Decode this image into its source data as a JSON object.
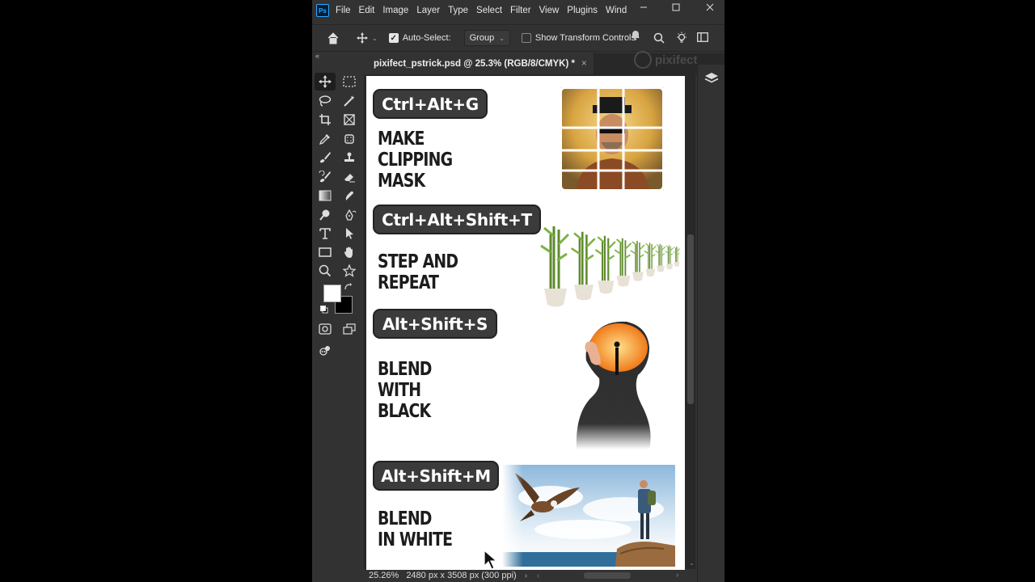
{
  "app": {
    "logo": "Ps",
    "menu": [
      "File",
      "Edit",
      "Image",
      "Layer",
      "Type",
      "Select",
      "Filter",
      "View",
      "Plugins",
      "Wind"
    ]
  },
  "options": {
    "auto_select_label": "Auto-Select:",
    "auto_select_checked": true,
    "group_value": "Group",
    "show_transform_label": "Show Transform Controls",
    "show_transform_checked": false
  },
  "collapse_glyph": "«",
  "tab": {
    "title": "pixifect_pstrick.psd @ 25.3% (RGB/8/CMYK) *",
    "close": "×"
  },
  "watermark": "pixifect",
  "shortcuts": [
    {
      "keys": "Ctrl+Alt+G",
      "lines": [
        "MAKE",
        "CLIPPING",
        "MASK"
      ]
    },
    {
      "keys": "Ctrl+Alt+Shift+T",
      "lines": [
        "STEP AND",
        "REPEAT"
      ]
    },
    {
      "keys": "Alt+Shift+S",
      "lines": [
        "BLEND",
        "WITH",
        "BLACK"
      ]
    },
    {
      "keys": "Alt+Shift+M",
      "lines": [
        "BLEND",
        "IN WHITE"
      ]
    }
  ],
  "status": {
    "zoom": "25.26%",
    "doc_size": "2480 px x 3508 px (300 ppi)"
  },
  "colors": {
    "foreground": "#ffffff",
    "background": "#000000",
    "accent": "#31a8ff"
  }
}
